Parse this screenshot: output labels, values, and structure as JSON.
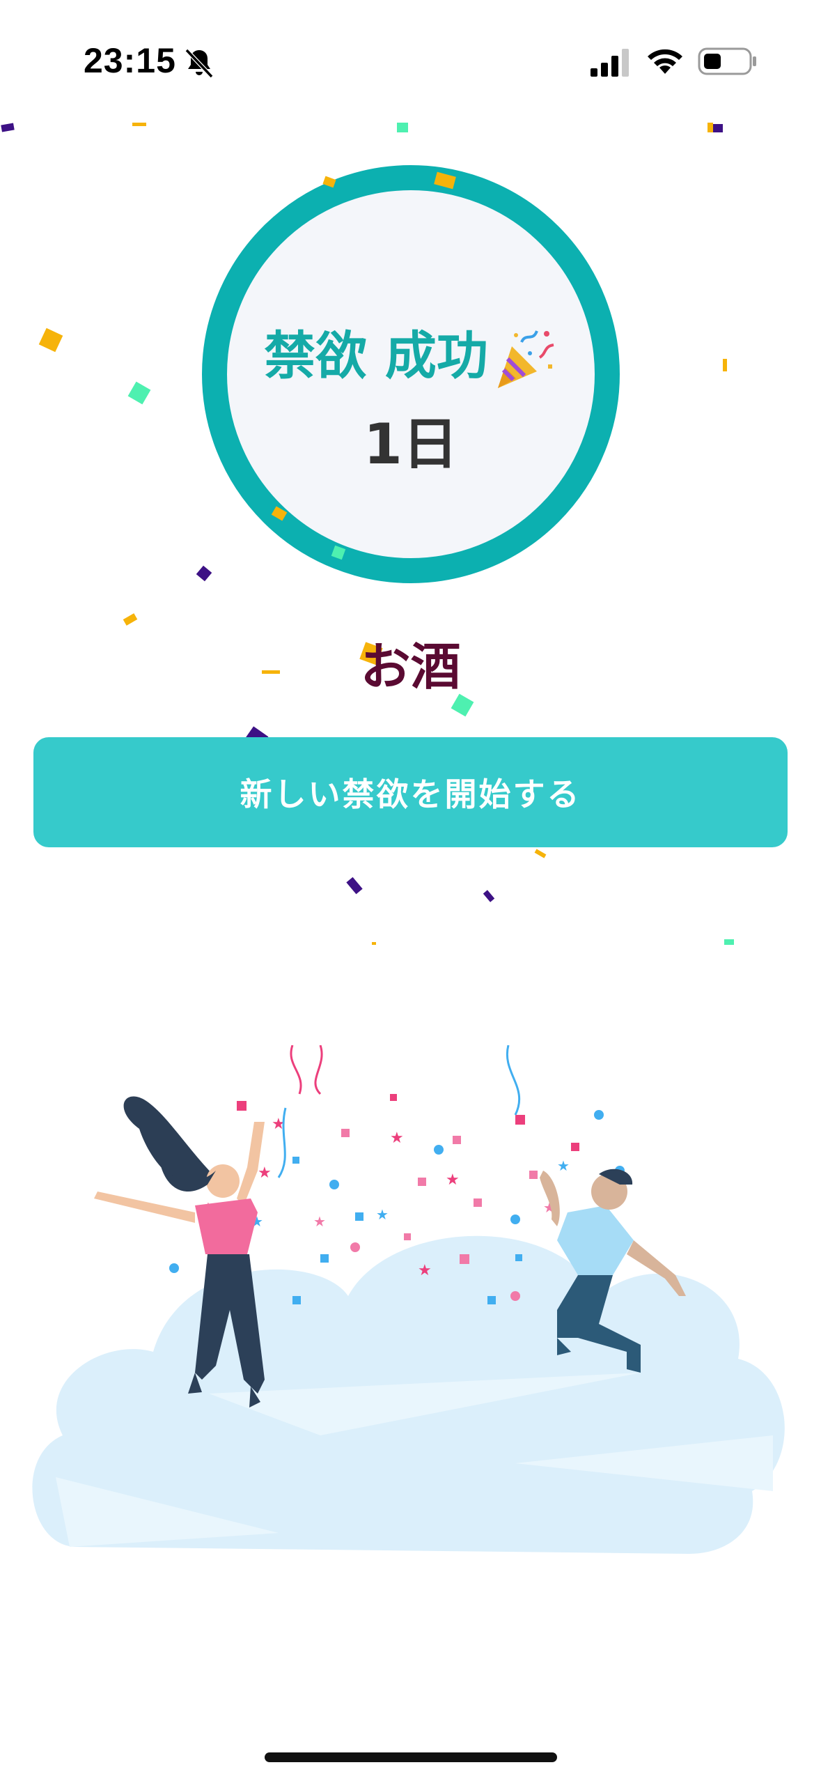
{
  "status_bar": {
    "time": "23:15",
    "icons": [
      "bell-slash-icon",
      "cellular-signal-icon",
      "wifi-icon",
      "battery-icon"
    ]
  },
  "result": {
    "title": "禁欲 成功",
    "title_emoji": "party-popper-icon",
    "days": "1日"
  },
  "habit": {
    "name": "お酒"
  },
  "actions": {
    "start_new_label": "新しい禁欲を開始する"
  },
  "illustration": {
    "subject": "celebration-people-confetti"
  },
  "colors": {
    "ring": "#0cb0b0",
    "title": "#15aaa7",
    "button": "#36cacb",
    "habit_name": "#5a0a32"
  }
}
